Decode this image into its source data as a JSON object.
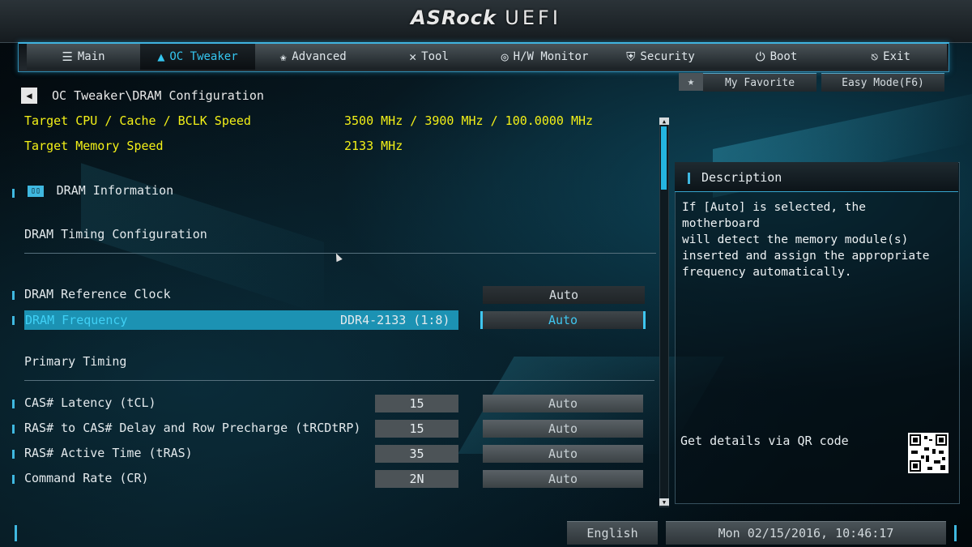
{
  "header": {
    "brand": "ASRock",
    "product": "UEFI"
  },
  "tabs": [
    {
      "label": "Main",
      "icon": "list-icon"
    },
    {
      "label": "OC Tweaker",
      "icon": "rocket-icon"
    },
    {
      "label": "Advanced",
      "icon": "star-icon"
    },
    {
      "label": "Tool",
      "icon": "tools-icon"
    },
    {
      "label": "H/W Monitor",
      "icon": "monitor-icon"
    },
    {
      "label": "Security",
      "icon": "shield-icon"
    },
    {
      "label": "Boot",
      "icon": "power-icon"
    },
    {
      "label": "Exit",
      "icon": "exit-icon"
    }
  ],
  "active_tab": "OC Tweaker",
  "breadcrumb": "OC Tweaker\\DRAM Configuration",
  "favorite": {
    "label": "My Favorite",
    "easy_mode": "Easy Mode(F6)"
  },
  "targets": {
    "cpu_label": "Target CPU / Cache / BCLK Speed",
    "cpu_value": "3500 MHz / 3900 MHz / 100.0000 MHz",
    "mem_label": "Target Memory Speed",
    "mem_value": "2133 MHz"
  },
  "sections": {
    "dram_info": "DRAM Information",
    "timing_config": "DRAM Timing Configuration",
    "primary_timing": "Primary Timing"
  },
  "settings": {
    "ref_clock": {
      "label": "DRAM Reference Clock",
      "option": "Auto"
    },
    "frequency": {
      "label": "DRAM Frequency",
      "current": "DDR4-2133 (1:8)",
      "option": "Auto"
    },
    "timings": [
      {
        "label": "CAS# Latency (tCL)",
        "value": "15",
        "option": "Auto"
      },
      {
        "label": "RAS# to CAS# Delay and Row Precharge (tRCDtRP)",
        "value": "15",
        "option": "Auto"
      },
      {
        "label": "RAS# Active Time (tRAS)",
        "value": "35",
        "option": "Auto"
      },
      {
        "label": "Command Rate (CR)",
        "value": "2N",
        "option": "Auto"
      }
    ]
  },
  "description": {
    "title": "Description",
    "text": "If [Auto] is selected, the motherboard\nwill detect the memory module(s)\ninserted and assign the appropriate\nfrequency automatically.",
    "qr_label": "Get details via QR code"
  },
  "footer": {
    "language": "English",
    "datetime": "Mon 02/15/2016, 10:46:17"
  },
  "colors": {
    "accent": "#3fb8e0",
    "highlight": "#1c92b3",
    "target_text": "#f3f017"
  }
}
